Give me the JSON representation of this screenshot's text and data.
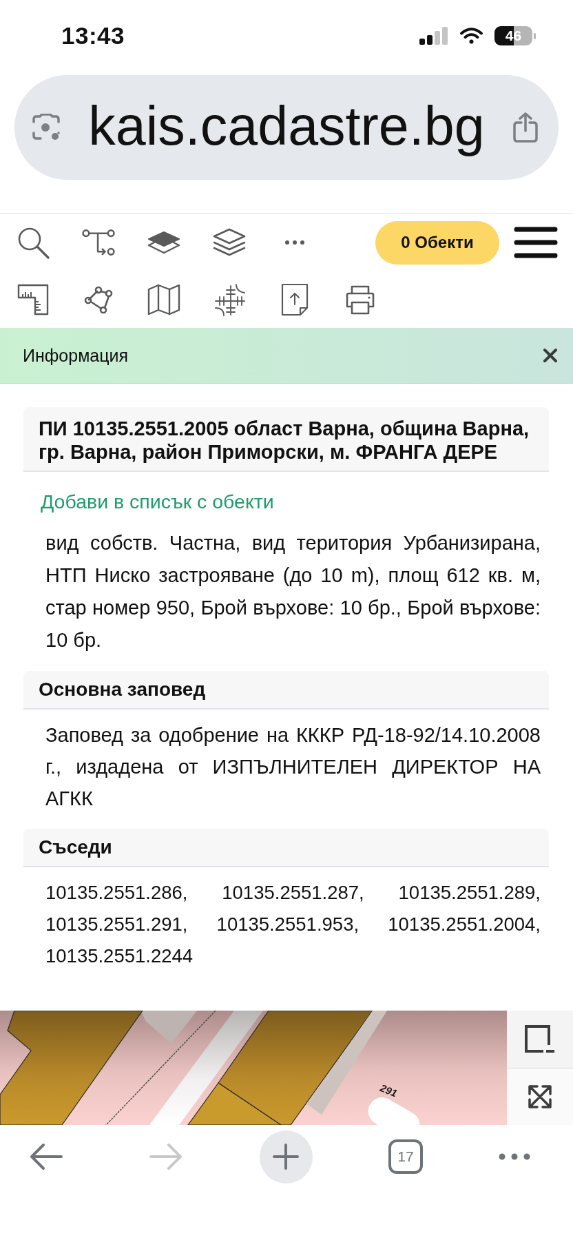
{
  "status_bar": {
    "time": "13:43",
    "battery": "46"
  },
  "address_bar": {
    "url": "kais.cadastre.bg"
  },
  "toolbar": {
    "objects_button": "0 Обекти"
  },
  "info_panel": {
    "title": "Информация",
    "parcel": {
      "heading": "ПИ 10135.2551.2005 област Варна, община Варна, гр. Варна, район Приморски, м. ФРАНГА ДЕРЕ",
      "add_link": "Добави в списък с обекти",
      "details": "вид собств. Частна, вид територия Урбанизирана, НТП Ниско застрояване (до 10 m), площ 612 кв. м, стар номер 950, Брой върхове: 10 бр., Брой върхове: 10 бр."
    },
    "sections": [
      {
        "heading": "Основна заповед",
        "text": "Заповед за одобрение на КККР РД-18-92/14.10.2008 г., издадена от ИЗПЪЛНИТЕЛЕН ДИРЕКТОР НА АГКК"
      },
      {
        "heading": "Съседи",
        "text": "10135.2551.286, 10135.2551.287, 10135.2551.289, 10135.2551.291, 10135.2551.953, 10135.2551.2004, 10135.2551.2244"
      }
    ]
  },
  "map": {
    "parcel_label": "291"
  },
  "bottom_bar": [
    {
      "kind": "back",
      "disabled": false
    },
    {
      "kind": "forward",
      "disabled": true
    },
    {
      "kind": "new-tab",
      "disabled": false
    },
    {
      "kind": "tabs",
      "label": "17",
      "disabled": false
    },
    {
      "kind": "more",
      "disabled": false
    }
  ]
}
